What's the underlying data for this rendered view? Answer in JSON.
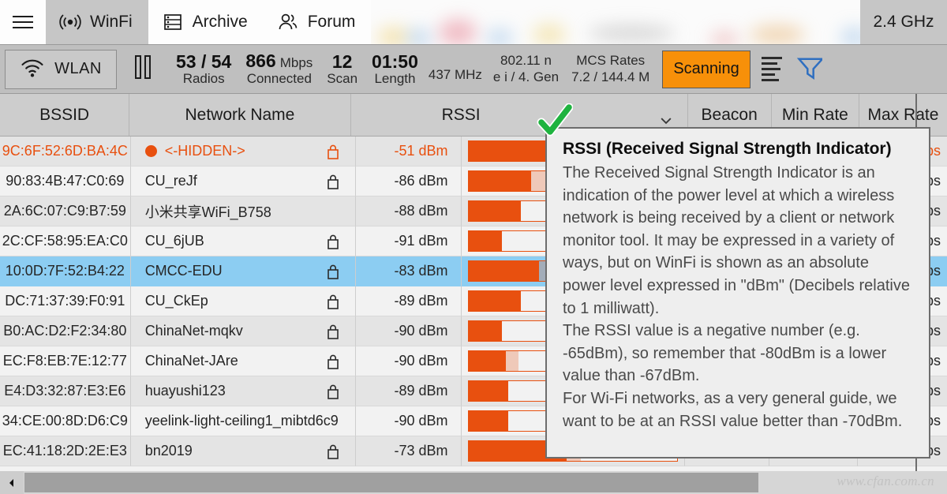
{
  "window": {
    "menu_icon": "hamburger-icon",
    "frequency_band": "2.4 GHz"
  },
  "tabs": [
    {
      "label": "WinFi",
      "icon": "broadcast-icon",
      "active": true
    },
    {
      "label": "Archive",
      "icon": "database-icon",
      "active": false
    },
    {
      "label": "Forum",
      "icon": "people-icon",
      "active": false
    }
  ],
  "toolbar": {
    "adapter_button": {
      "label": "WLAN",
      "icon": "wifi-icon"
    },
    "pause_button": {
      "icon": "pause-icon"
    },
    "stats": [
      {
        "value": "53 / 54",
        "unit": "",
        "label": "Radios"
      },
      {
        "value": "866",
        "unit": "Mbps",
        "label": "Connected"
      },
      {
        "value": "12",
        "unit": "",
        "label": "Scan"
      },
      {
        "value": "01:50",
        "unit": "",
        "label": "Length"
      }
    ],
    "frequency": "437 MHz",
    "standard": {
      "line1": "802.11 n",
      "line2": "e i / 4. Gen"
    },
    "mcs": {
      "line1": "MCS Rates",
      "line2": "7.2 / 144.4 M"
    },
    "scan_status": "Scanning",
    "scan_status_color": "#f79009",
    "sort_icon": "sort-descending-icon",
    "filter_icon": "filter-funnel-icon",
    "filter_color": "#2f6fc0"
  },
  "table": {
    "columns": [
      {
        "key": "bssid",
        "label": "BSSID"
      },
      {
        "key": "name",
        "label": "Network Name"
      },
      {
        "key": "rssi",
        "label": "RSSI",
        "sorted": true,
        "sort_icon": "chevron-down-icon"
      },
      {
        "key": "bar",
        "label": ""
      },
      {
        "key": "beacon",
        "label": "Beacon"
      },
      {
        "key": "min",
        "label": "Min Rate"
      },
      {
        "key": "max",
        "label": "Max Rate"
      }
    ],
    "rows": [
      {
        "bssid": "9C:6F:52:6D:BA:4C",
        "name": "<-HIDDEN->",
        "rssi": "-51 dBm",
        "pct": 100,
        "ghost": 0,
        "locked": true,
        "highlight": true,
        "selected": false,
        "max": "ps"
      },
      {
        "bssid": "90:83:4B:47:C0:69",
        "name": "CU_reJf",
        "rssi": "-86 dBm",
        "pct": 30,
        "ghost": 9,
        "locked": true,
        "highlight": false,
        "selected": false,
        "max": "ps"
      },
      {
        "bssid": "2A:6C:07:C9:B7:59",
        "name": "小米共享WiFi_B758",
        "rssi": "-88 dBm",
        "pct": 25,
        "ghost": 0,
        "locked": false,
        "highlight": false,
        "selected": false,
        "max": "ps"
      },
      {
        "bssid": "2C:CF:58:95:EA:C0",
        "name": "CU_6jUB",
        "rssi": "-91 dBm",
        "pct": 16,
        "ghost": 0,
        "locked": true,
        "highlight": false,
        "selected": false,
        "max": "ps"
      },
      {
        "bssid": "10:0D:7F:52:B4:22",
        "name": "CMCC-EDU",
        "rssi": "-83 dBm",
        "pct": 34,
        "ghost": 6,
        "locked": true,
        "highlight": false,
        "selected": true,
        "max": "ps"
      },
      {
        "bssid": "DC:71:37:39:F0:91",
        "name": "CU_CkEp",
        "rssi": "-89 dBm",
        "pct": 25,
        "ghost": 0,
        "locked": true,
        "highlight": false,
        "selected": false,
        "max": "ps"
      },
      {
        "bssid": "B0:AC:D2:F2:34:80",
        "name": "ChinaNet-mqkv",
        "rssi": "-90 dBm",
        "pct": 16,
        "ghost": 0,
        "locked": true,
        "highlight": false,
        "selected": false,
        "max": "ps"
      },
      {
        "bssid": "EC:F8:EB:7E:12:77",
        "name": "ChinaNet-JAre",
        "rssi": "-90 dBm",
        "pct": 18,
        "ghost": 6,
        "locked": true,
        "highlight": false,
        "selected": false,
        "max": "ps"
      },
      {
        "bssid": "E4:D3:32:87:E3:E6",
        "name": "huayushi123",
        "rssi": "-89 dBm",
        "pct": 19,
        "ghost": 0,
        "locked": true,
        "highlight": false,
        "selected": false,
        "max": "ps"
      },
      {
        "bssid": "34:CE:00:8D:D6:C9",
        "name": "yeelink-light-ceiling1_mibtd6c9",
        "rssi": "-90 dBm",
        "pct": 19,
        "ghost": 0,
        "locked": false,
        "highlight": false,
        "selected": false,
        "max": "ps"
      },
      {
        "bssid": "EC:41:18:2D:2E:E3",
        "name": "bn2019",
        "rssi": "-73 dBm",
        "pct": 47,
        "ghost": 7,
        "locked": true,
        "highlight": false,
        "selected": false,
        "max": "ps"
      }
    ]
  },
  "tooltip": {
    "title": "RSSI (Received Signal Strength Indicator)",
    "paragraphs": [
      "The Received Signal Strength Indicator is an indication of the power level at which a wireless network is being received by a client or network monitor tool. It may be expressed in a variety of ways, but on WinFi is shown as an absolute power level expressed in \"dBm\" (Decibels relative to 1 milliwatt).",
      "The RSSI value is a negative number (e.g. -65dBm), so remember that -80dBm is a lower value than -67dBm.",
      "For Wi-Fi networks, as a very general guide, we want to be at an RSSI value better than -70dBm."
    ],
    "marker_icon": "green-check-icon",
    "marker_color": "#1fb33f"
  },
  "footer": {
    "scroll_left_icon": "arrow-left-icon",
    "watermark": "www.cfan.com.cn"
  },
  "colors": {
    "accent_orange": "#e8500f",
    "selection_blue": "#8ccdf2",
    "toolbar_gray": "#bfbfbf",
    "header_gray": "#cdcdcd"
  }
}
